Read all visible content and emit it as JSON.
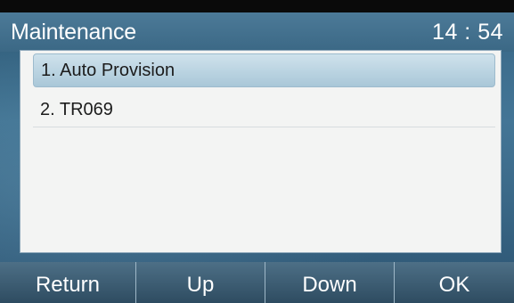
{
  "header": {
    "title": "Maintenance",
    "clock": "14 : 54"
  },
  "menu": {
    "items": [
      {
        "label": "1. Auto Provision",
        "selected": true
      },
      {
        "label": "2. TR069",
        "selected": false
      }
    ]
  },
  "softkeys": [
    {
      "label": "Return"
    },
    {
      "label": "Up"
    },
    {
      "label": "Down"
    },
    {
      "label": "OK"
    }
  ],
  "colors": {
    "title_bar": "#436f8c",
    "selection": "#b8d3e2",
    "list_background": "#f3f4f3",
    "softkey": "#3e5e74"
  }
}
